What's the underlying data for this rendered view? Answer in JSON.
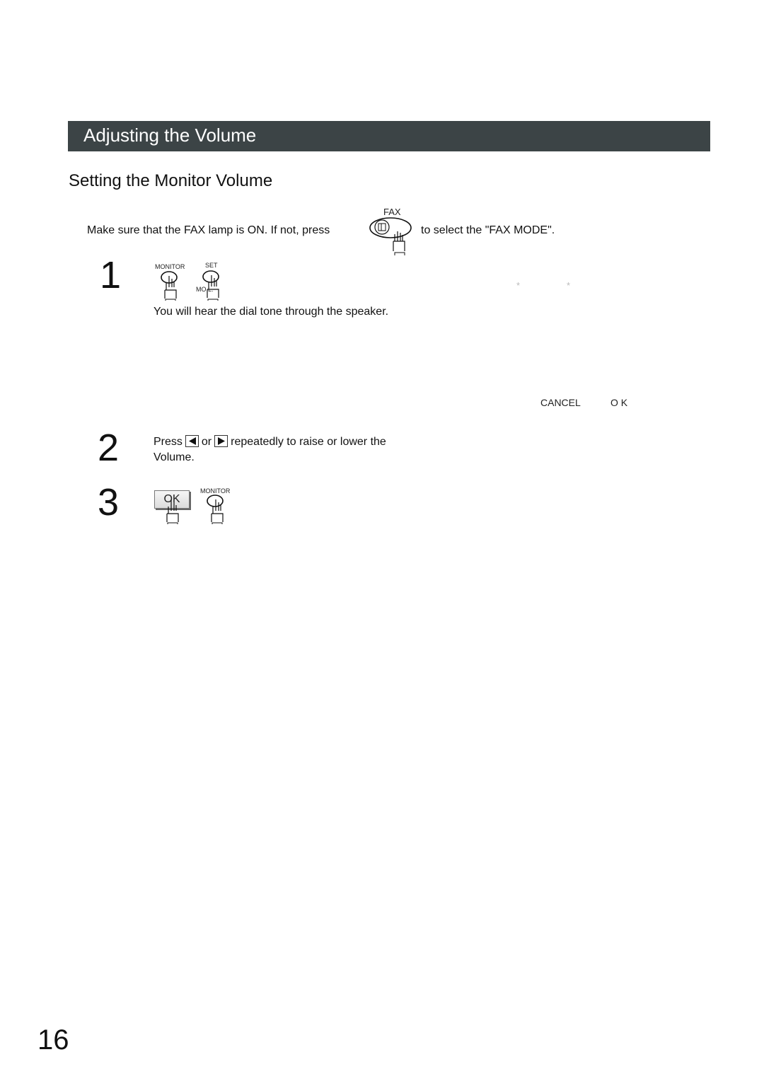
{
  "section": {
    "title": "Adjusting the Volume"
  },
  "subsection": {
    "title": "Setting the Monitor Volume"
  },
  "intro": {
    "text_before": "Make sure that the FAX lamp is ON.  If not, press",
    "key_label": "FAX",
    "key_icon": "fax-mode-button-icon",
    "text_after": "to select the \"FAX MODE\"."
  },
  "steps": [
    {
      "number": "1",
      "keys": [
        {
          "label": "MONITOR",
          "icon": "round-button-press-icon"
        },
        {
          "label": "SET",
          "sublabel": "MO   L.",
          "icon": "round-button-press-icon"
        }
      ],
      "display_marks": [
        "*",
        "*"
      ],
      "text": "You will hear the dial tone through the speaker.",
      "display_labels": [
        "CANCEL",
        "O K"
      ]
    },
    {
      "number": "2",
      "text_press": "Press",
      "left_key_icon": "left-arrow-key-icon",
      "text_or": "or",
      "right_key_icon": "right-arrow-key-icon",
      "text_rest": "repeatedly to raise or lower the",
      "text_line2": "Volume."
    },
    {
      "number": "3",
      "keys": [
        {
          "label": "OK",
          "icon": "ok-key-press-icon"
        },
        {
          "label": "MONITOR",
          "icon": "round-button-press-icon"
        }
      ]
    }
  ],
  "page": {
    "number": "16"
  },
  "colors": {
    "section_bar": "#3c4446",
    "section_text": "#ffffff"
  }
}
